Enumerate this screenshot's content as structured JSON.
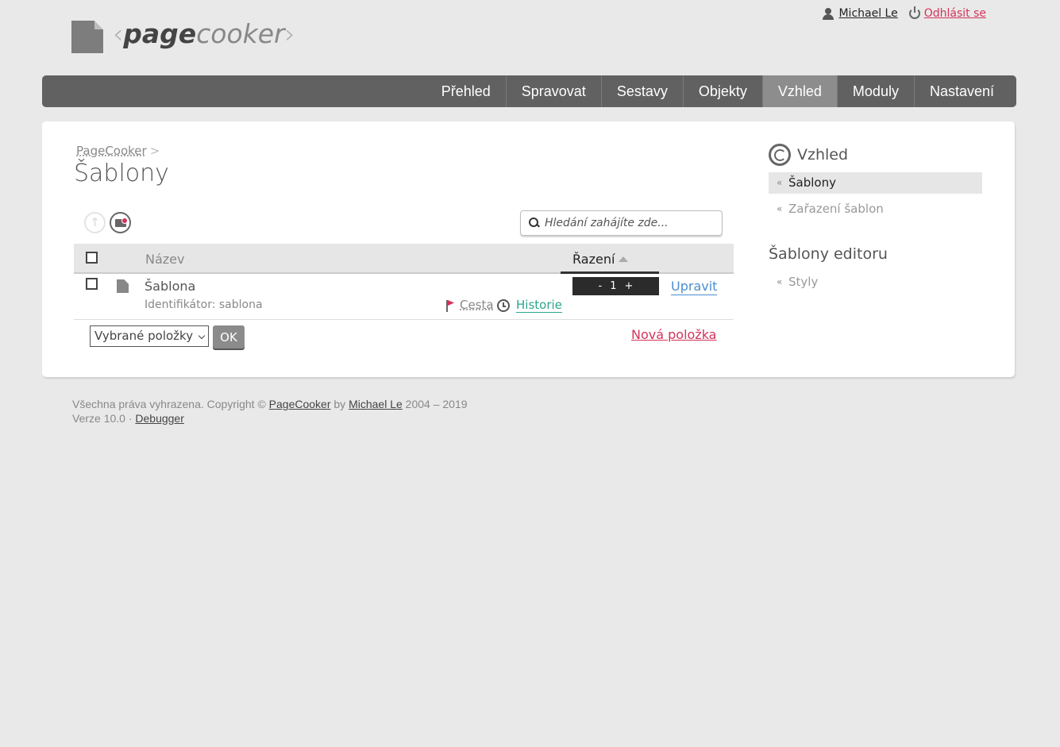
{
  "header": {
    "logo": {
      "left_bracket": "‹",
      "part1": "page",
      "part2": "cooker",
      "right_bracket": "›"
    },
    "user_name": "Michael Le",
    "logout_label": "Odhlásit se"
  },
  "nav": {
    "items": [
      "Přehled",
      "Spravovat",
      "Sestavy",
      "Objekty",
      "Vzhled",
      "Moduly",
      "Nastavení"
    ],
    "active": "Vzhled"
  },
  "main": {
    "breadcrumb": {
      "root": "PageCooker",
      "separator": ">"
    },
    "title": "Šablony",
    "search_placeholder": "Hledání zahájíte zde...",
    "table": {
      "col_name": "Název",
      "col_sort": "Řazení",
      "rows": [
        {
          "name": "Šablona",
          "identifier": "Identifikátor: sablona",
          "cesta": "Cesta",
          "historie": "Historie",
          "order": "1",
          "edit": "Upravit"
        }
      ]
    },
    "stepper": {
      "minus": "-",
      "plus": "+"
    },
    "bulk_select": "Vybrané položky",
    "ok_label": "OK",
    "new_item": "Nová položka"
  },
  "sidebar": {
    "section1_title": "Vzhled",
    "section1_items": [
      "Šablony",
      "Zařazení šablon"
    ],
    "section2_title": "Šablony editoru",
    "section2_items": [
      "Styly"
    ]
  },
  "footer": {
    "rights": "Všechna práva vyhrazena. Copyright ©",
    "product": "PageCooker",
    "by": "by",
    "author": "Michael Le",
    "years": "2004 – 2019",
    "version": "Verze 10.0",
    "dot": "·",
    "debugger": "Debugger"
  },
  "colors": {
    "accent_red": "#d4335a",
    "nav_bg": "#616161",
    "nav_active": "#8d8d8d",
    "link_blue": "#4a8ed1",
    "link_green": "#2aa58e"
  }
}
